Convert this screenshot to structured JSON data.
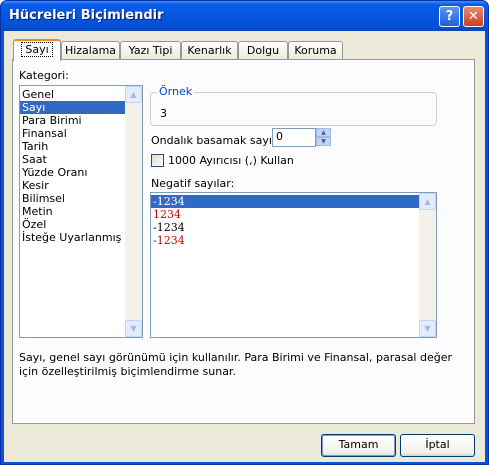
{
  "window": {
    "title": "Hücreleri Biçimlendir",
    "help_glyph": "?",
    "close_glyph": "✕"
  },
  "tabs": [
    {
      "label": "Sayı",
      "active": true
    },
    {
      "label": "Hizalama",
      "active": false
    },
    {
      "label": "Yazı Tipi",
      "active": false
    },
    {
      "label": "Kenarlık",
      "active": false
    },
    {
      "label": "Dolgu",
      "active": false
    },
    {
      "label": "Koruma",
      "active": false
    }
  ],
  "category": {
    "label": "Kategori:",
    "items": [
      "Genel",
      "Sayı",
      "Para Birimi",
      "Finansal",
      "Tarih",
      "Saat",
      "Yüzde Oranı",
      "Kesir",
      "Bilimsel",
      "Metin",
      "Özel",
      "İsteğe Uyarlanmış"
    ],
    "selected_index": 1
  },
  "sample": {
    "title": "Örnek",
    "value": "3"
  },
  "decimal": {
    "label": "Ondalık basamak sayısı:",
    "value": "0"
  },
  "separator": {
    "label": "1000 Ayırıcısı (,) Kullan",
    "checked": false
  },
  "negative": {
    "label": "Negatif sayılar:",
    "items": [
      {
        "text": "-1234",
        "color": "#000000",
        "selected": true
      },
      {
        "text": "1234",
        "color": "#cc0000",
        "selected": false
      },
      {
        "text": "-1234",
        "color": "#000000",
        "selected": false
      },
      {
        "text": "-1234",
        "color": "#cc0000",
        "selected": false
      }
    ]
  },
  "description": "Sayı, genel sayı görünümü için kullanılır. Para Birimi ve Finansal, parasal değer için özelleştirilmiş biçimlendirme sunar.",
  "buttons": {
    "ok": "Tamam",
    "cancel": "İptal"
  },
  "colors": {
    "title_bar": "#0556e0",
    "selection": "#316ac5",
    "group_title": "#0046d5",
    "negative_red": "#cc0000",
    "active_tab_accent": "#e68b2c"
  }
}
